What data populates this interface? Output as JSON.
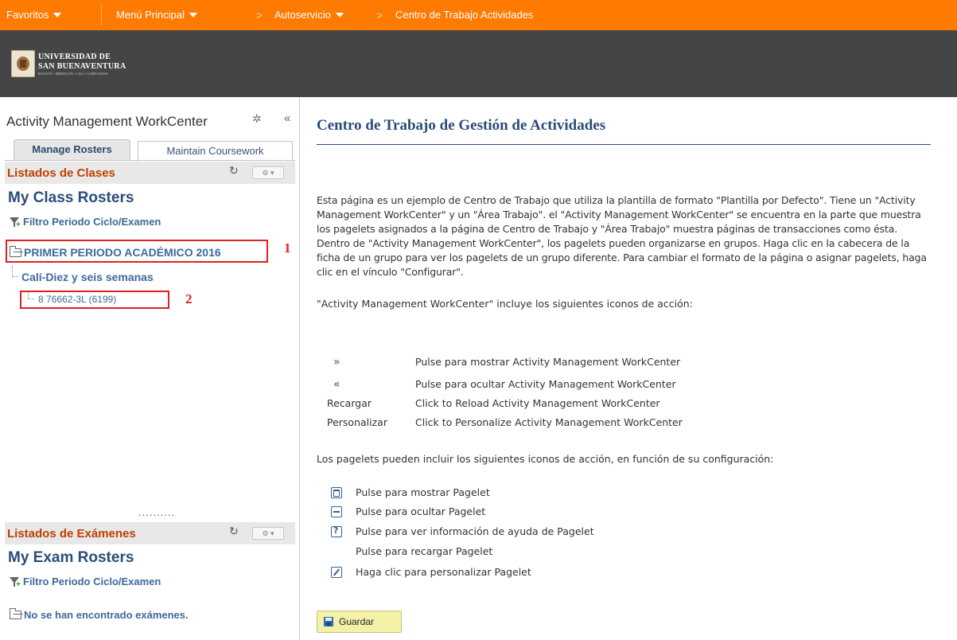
{
  "topnav": {
    "favorites": "Favoritos",
    "main_menu": "Menú Principal",
    "self_service": "Autoservicio",
    "current_page": "Centro de Trabajo Actividades"
  },
  "logo": {
    "line1": "Universidad de",
    "line2": "San Buenaventura",
    "line3": "Bogotá • Medellín • Cali • Cartagena"
  },
  "workcenter": {
    "title": "Activity Management WorkCenter",
    "collapse_symbol": "«",
    "tabs": [
      {
        "label": "Manage Rosters",
        "active": true
      },
      {
        "label": "Maintain Coursework",
        "active": false
      }
    ],
    "class_pagelet": {
      "header": "Listados de Clases",
      "title": "My Class Rosters",
      "filter_label": "Filtro Periodo Ciclo/Examen",
      "period": "PRIMER PERIODO ACADÉMICO 2016",
      "campus_session": "Calí-Diez y seis semanas",
      "course": "8 76662-3L (6199)",
      "annotation_1": "1",
      "annotation_2": "2"
    },
    "splitter_dots": "..........",
    "exam_pagelet": {
      "header": "Listados de Exámenes",
      "title": "My Exam Rosters",
      "filter_label": "Filtro Periodo Ciclo/Examen",
      "empty_message": "No se han encontrado exámenes."
    }
  },
  "content": {
    "title": "Centro de Trabajo de Gestión de Actividades",
    "intro": "Esta página es un ejemplo de Centro de Trabajo que utiliza la plantilla de formato \"Plantilla por Defecto\". Tiene un \"Activity Management WorkCenter\" y un \"Área Trabajo\". el \"Activity Management WorkCenter\" se encuentra en la parte que muestra los pagelets asignados a la página de Centro de Trabajo y \"Área Trabajo\" muestra páginas de transacciones como ésta. Dentro de \"Activity Management WorkCenter\", los pagelets pueden organizarse en grupos. Haga clic en la cabecera de la ficha de un grupo para ver los pagelets de un grupo diferente. Para cambiar el formato de la página o asignar pagelets, haga clic en el vínculo \"Configurar\".",
    "wc_icons_intro": "\"Activity Management WorkCenter\" incluye los siguientes iconos de acción:",
    "wc_icons": [
      {
        "symbol": "»",
        "desc": "Pulse para mostrar Activity Management WorkCenter"
      },
      {
        "symbol": "«",
        "desc": "Pulse para ocultar Activity Management WorkCenter"
      },
      {
        "symbol": "Recargar",
        "desc": "Click to Reload Activity Management WorkCenter"
      },
      {
        "symbol": "Personalizar",
        "desc": "Click to Personalize Activity Management WorkCenter"
      }
    ],
    "pagelet_icons_intro": "Los pagelets pueden incluir los siguientes iconos de acción, en función de su configuración:",
    "pagelet_icons": [
      {
        "icon": "maximize-icon",
        "desc": "Pulse para mostrar Pagelet"
      },
      {
        "icon": "minimize-icon",
        "desc": "Pulse para ocultar Pagelet"
      },
      {
        "icon": "help-icon",
        "desc": "Pulse para ver información de ayuda de Pagelet"
      },
      {
        "icon": "",
        "desc": "Pulse para recargar Pagelet"
      },
      {
        "icon": "edit-icon",
        "desc": "Haga clic para personalizar Pagelet"
      }
    ],
    "save_label": "Guardar"
  },
  "colors": {
    "nav_orange": "#ff7a00",
    "banner_gray": "#444546",
    "title_blue": "#2a4d78",
    "header_orange": "#c04000",
    "annotation_red": "#e02020",
    "save_yellow": "#f3f0a8"
  }
}
